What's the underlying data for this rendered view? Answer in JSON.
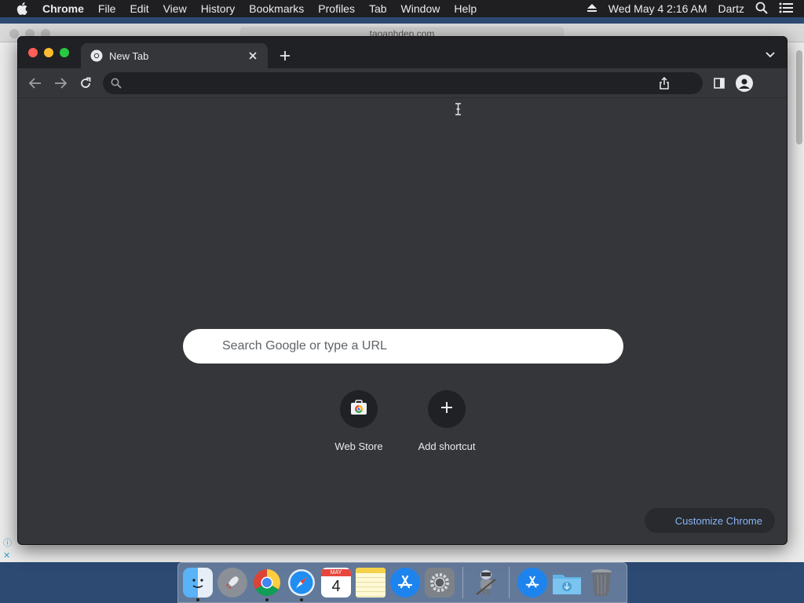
{
  "menubar": {
    "app": "Chrome",
    "items": [
      "File",
      "Edit",
      "View",
      "History",
      "Bookmarks",
      "Profiles",
      "Tab",
      "Window",
      "Help"
    ],
    "clock": "Wed May 4  2:16 AM",
    "user": "Dartz"
  },
  "background_window": {
    "url": "taoanhdep.com"
  },
  "chrome": {
    "tab_title": "New Tab",
    "omnibox_value": "",
    "ntp": {
      "search_placeholder": "Search Google or type a URL",
      "shortcuts": [
        {
          "label": "Web Store",
          "icon": "web-store-icon"
        },
        {
          "label": "Add shortcut",
          "icon": "plus-icon"
        }
      ],
      "customize_label": "Customize Chrome"
    }
  },
  "dock": {
    "apps": [
      "finder",
      "launchpad",
      "chrome",
      "safari",
      "calendar",
      "notes",
      "app-store",
      "system-preferences",
      "automator",
      "applications-folder",
      "downloads-folder",
      "trash"
    ],
    "calendar_month": "MAY",
    "calendar_day": "4"
  },
  "colors": {
    "chrome_bg": "#35363a",
    "tabstrip_bg": "#202124",
    "accent_link": "#8ab4f8"
  }
}
